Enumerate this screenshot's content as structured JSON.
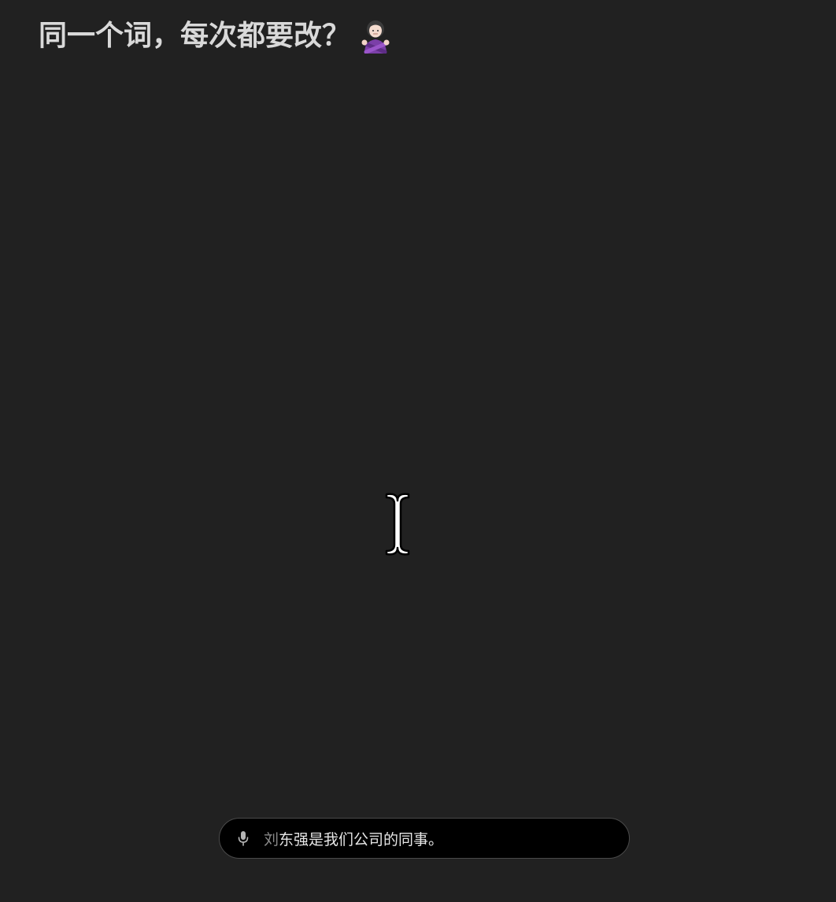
{
  "headline": {
    "text": "同一个词，每次都要改？",
    "emoji": "person-gesturing-no-icon"
  },
  "cursor": {
    "icon": "text-cursor-icon"
  },
  "dictation": {
    "icon": "microphone-icon",
    "transcript_pending": "刘",
    "transcript_confirmed": "东强是我们公司的同事。"
  }
}
